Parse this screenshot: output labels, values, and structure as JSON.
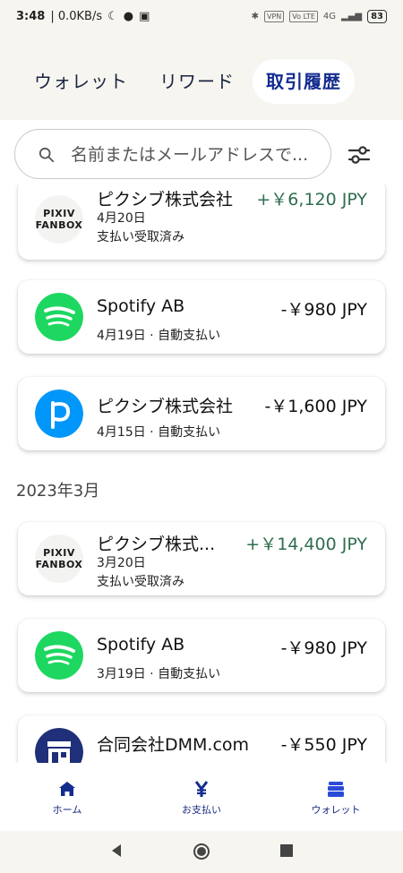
{
  "status_bar": {
    "time": "3:48",
    "speed": "| 0.0KB/s",
    "vpn": "VPN",
    "lte": "Vo LTE",
    "net": "4G",
    "battery": "83"
  },
  "tabs": [
    {
      "label": "ウォレット"
    },
    {
      "label": "リワード"
    },
    {
      "label": "取引履歴",
      "active": true
    }
  ],
  "search": {
    "placeholder": "名前またはメールアドレスで..."
  },
  "transactions": [
    {
      "merchant": "ピクシブ株式会社",
      "amount": "+￥6,120 JPY",
      "date": "4月20日",
      "status": "支払い受取済み",
      "logo": "pixiv-fanbox-logo"
    },
    {
      "merchant": "Spotify AB",
      "amount": "-￥980 JPY",
      "date": "4月19日 · 自動支払い",
      "logo": "spotify-logo"
    },
    {
      "merchant": "ピクシブ株式会社",
      "amount": "-￥1,600 JPY",
      "date": "4月15日 · 自動支払い",
      "logo": "pixiv-logo"
    }
  ],
  "month_header": "2023年3月",
  "transactions_march": [
    {
      "merchant": "ピクシブ株式...",
      "amount": "+￥14,400 JPY",
      "date": "3月20日",
      "status": "支払い受取済み",
      "logo": "pixiv-fanbox-logo"
    },
    {
      "merchant": "Spotify AB",
      "amount": "-￥980 JPY",
      "date": "3月19日 · 自動支払い",
      "logo": "spotify-logo"
    },
    {
      "merchant": "合同会社DMM.com",
      "amount": "-￥550 JPY",
      "date": "",
      "logo": "dmm-store-logo"
    }
  ],
  "fanbox_logo_text": [
    "PIXIV",
    "FANBOX"
  ],
  "bottom_nav": [
    {
      "label": "ホーム",
      "icon": "home-icon"
    },
    {
      "label": "お支払い",
      "icon": "yen-icon"
    },
    {
      "label": "ウォレット",
      "icon": "wallet-icon"
    }
  ],
  "colors": {
    "accent": "#142c8e",
    "positive": "#2f6e4e",
    "header_bg": "#f6f5f0",
    "spotify": "#1ed760",
    "pixiv": "#0096fa",
    "dmm": "#1f2f7a"
  }
}
